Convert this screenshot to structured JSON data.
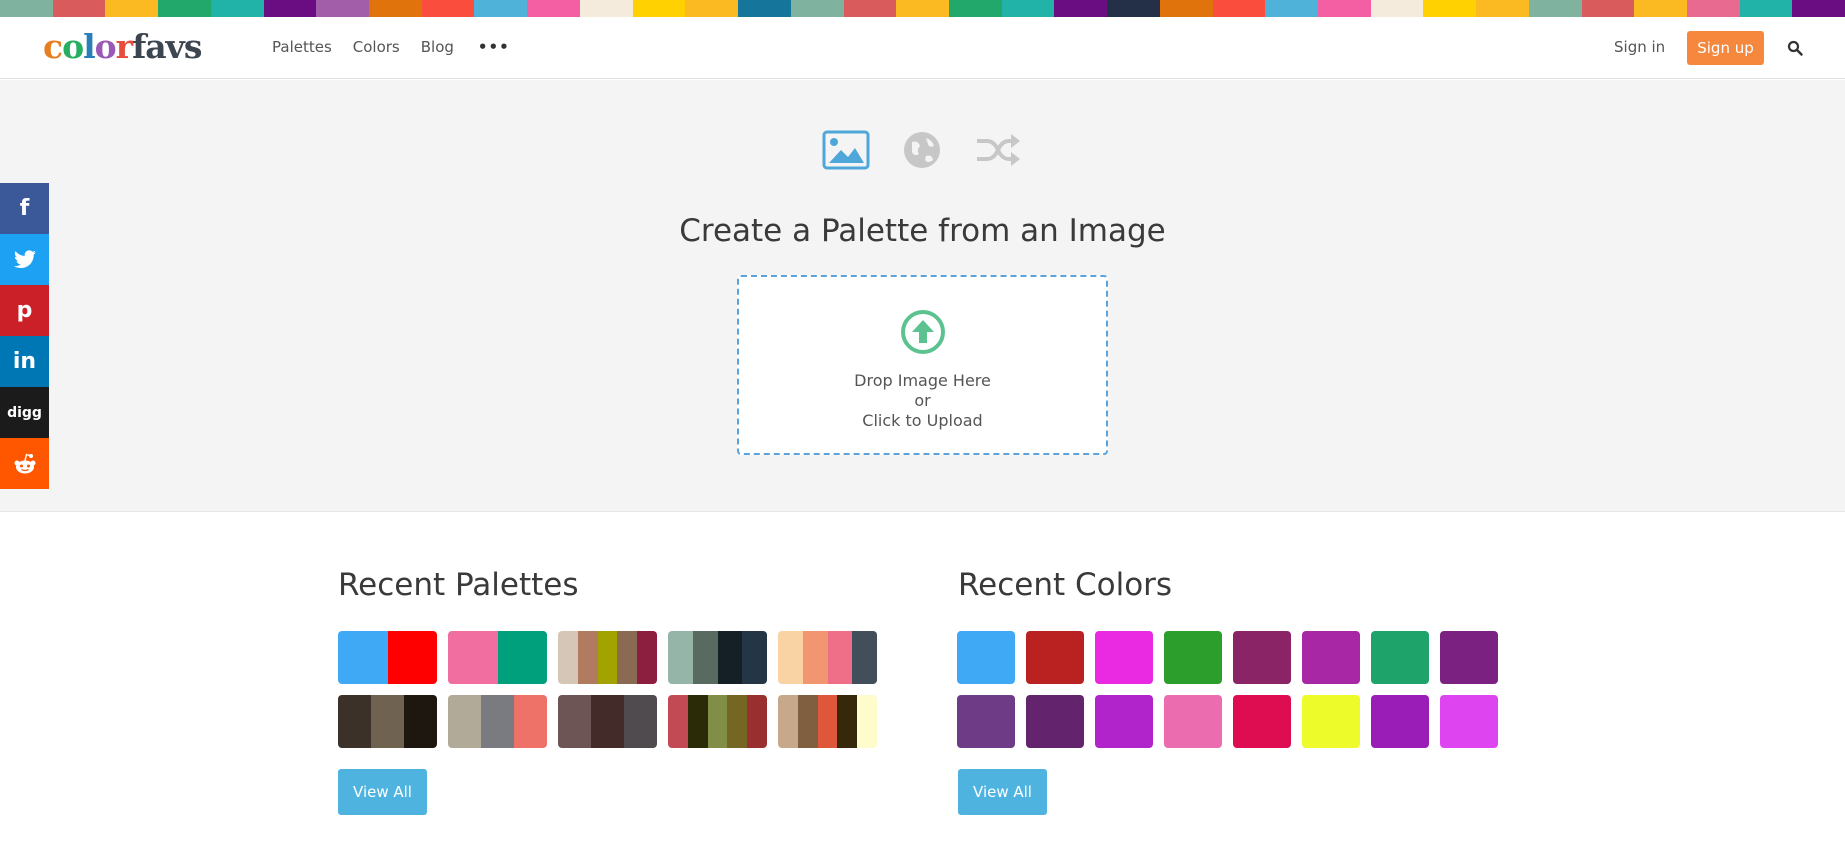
{
  "topbar_colors": [
    "#7fb3a0",
    "#d95b5b",
    "#fbb922",
    "#22a86a",
    "#22b3a8",
    "#6a0d83",
    "#a25ea8",
    "#e0730c",
    "#fb4d3d",
    "#4fb3d9",
    "#f45ea2",
    "#f4ebdc",
    "#ffd100",
    "#fbb922",
    "#16759b",
    "#7fb3a0",
    "#d95b5b",
    "#fbb922",
    "#22a86a",
    "#22b3a8",
    "#6a0d83",
    "#243047",
    "#e0730c",
    "#fb4d3d",
    "#4fb3d9",
    "#f45ea2",
    "#f4ebdc",
    "#ffd100",
    "#fbb922",
    "#7fb3a0",
    "#d95b5b",
    "#fbb922",
    "#e86a90",
    "#22b3a8",
    "#6a0d83"
  ],
  "header": {
    "logo_parts": [
      "c",
      "o",
      "l",
      "o",
      "r"
    ],
    "logo_favs": "favs",
    "nav": [
      "Palettes",
      "Colors",
      "Blog"
    ],
    "more_label": "•••",
    "signin": "Sign in",
    "signup": "Sign up",
    "search_icon": "search-icon"
  },
  "hero": {
    "title": "Create a Palette from an Image",
    "mode_icons": [
      "image-icon",
      "globe-icon",
      "shuffle-icon"
    ],
    "dropzone": {
      "line1": "Drop Image Here",
      "line2": "or",
      "line3": "Click to Upload"
    }
  },
  "social": [
    "f",
    "t",
    "p",
    "in",
    "digg",
    "reddit"
  ],
  "recent_palettes": {
    "title": "Recent Palettes",
    "view_all": "View All",
    "items": [
      [
        "#3fa9f5",
        "#ff0000"
      ],
      [
        "#f06fa0",
        "#00a07d"
      ],
      [
        "#d6c6b8",
        "#b07b5e",
        "#a3a300",
        "#8a6a52",
        "#8c1f3f"
      ],
      [
        "#95b5a8",
        "#596b60",
        "#151f26",
        "#243645"
      ],
      [
        "#f9d3a3",
        "#f29672",
        "#ee6f87",
        "#424e5a"
      ],
      [
        "#3c3128",
        "#6f6250",
        "#1e1710"
      ],
      [
        "#b2aa98",
        "#7a7b81",
        "#ef7269"
      ],
      [
        "#6d5455",
        "#432b2a",
        "#4f4b4e"
      ],
      [
        "#c14a55",
        "#2b2b08",
        "#818e47",
        "#766623",
        "#9a2f2f"
      ],
      [
        "#c7a88a",
        "#7f5f3f",
        "#de573a",
        "#36290b",
        "#fffccc"
      ]
    ]
  },
  "recent_colors": {
    "title": "Recent Colors",
    "view_all": "View All",
    "items": [
      "#3fa9f5",
      "#ba2222",
      "#ea2ae3",
      "#2b9e2b",
      "#8b2467",
      "#a727a4",
      "#1ea36b",
      "#7b2182",
      "#6e3b87",
      "#63236d",
      "#b124cc",
      "#ec6cb0",
      "#de0d52",
      "#eefb2b",
      "#9a1db8",
      "#de44ef"
    ]
  }
}
